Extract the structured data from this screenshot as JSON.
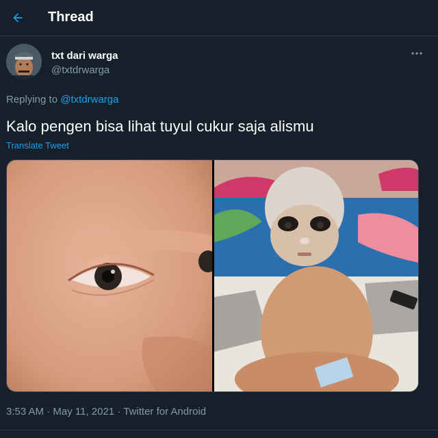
{
  "header": {
    "title": "Thread",
    "back_icon": "arrow-left-icon"
  },
  "tweet": {
    "author": {
      "display_name": "txt dari warga",
      "handle": "@txtdrwarga"
    },
    "more_icon": "more-horizontal-icon",
    "replying_prefix": "Replying to",
    "replying_to": "@txtdrwarga",
    "text": "Kalo pengen bisa lihat tuyul cukur saja alismu",
    "translate_label": "Translate Tweet",
    "timestamp": {
      "time": "3:53 AM",
      "sep1": " · ",
      "date": "May 11, 2021",
      "sep2": " · ",
      "source": "Twitter for Android"
    }
  },
  "colors": {
    "background": "#15202b",
    "accent": "#1da1f2",
    "secondary_text": "#8899a6",
    "divider": "#2f3b47"
  }
}
